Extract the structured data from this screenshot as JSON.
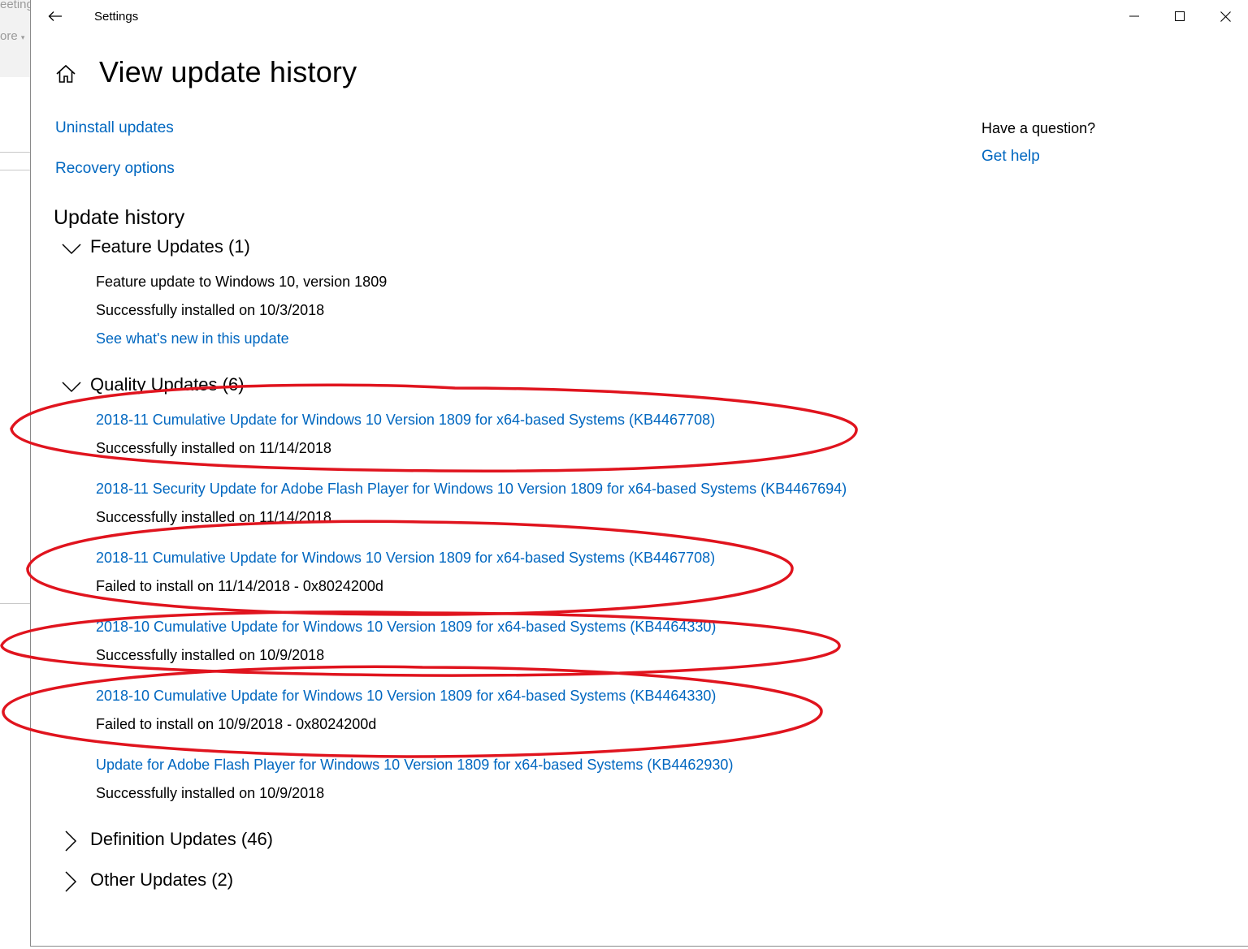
{
  "background_app": {
    "fragments": [
      "eeting",
      "ore"
    ]
  },
  "window": {
    "title": "Settings",
    "back_icon": "arrow-left-icon",
    "minimize_icon": "minimize-icon",
    "maximize_icon": "maximize-icon",
    "close_icon": "close-icon"
  },
  "page": {
    "home_icon": "home-icon",
    "title": "View update history"
  },
  "links": {
    "uninstall": "Uninstall updates",
    "recovery": "Recovery options"
  },
  "help": {
    "question": "Have a question?",
    "get_help": "Get help"
  },
  "history": {
    "heading": "Update history",
    "feature": {
      "header": "Feature Updates (1)",
      "expanded": true,
      "items": [
        {
          "title": "Feature update to Windows 10, version 1809",
          "status": "Successfully installed on 10/3/2018",
          "link": "See what's new in this update"
        }
      ]
    },
    "quality": {
      "header": "Quality Updates (6)",
      "expanded": true,
      "items": [
        {
          "title": "2018-11 Cumulative Update for Windows 10 Version 1809 for x64-based Systems (KB4467708)",
          "status": "Successfully installed on 11/14/2018"
        },
        {
          "title": "2018-11 Security Update for Adobe Flash Player for Windows 10 Version 1809 for x64-based Systems (KB4467694)",
          "status": "Successfully installed on 11/14/2018"
        },
        {
          "title": "2018-11 Cumulative Update for Windows 10 Version 1809 for x64-based Systems (KB4467708)",
          "status": "Failed to install on 11/14/2018 - 0x8024200d"
        },
        {
          "title": "2018-10 Cumulative Update for Windows 10 Version 1809 for x64-based Systems (KB4464330)",
          "status": "Successfully installed on 10/9/2018"
        },
        {
          "title": "2018-10 Cumulative Update for Windows 10 Version 1809 for x64-based Systems (KB4464330)",
          "status": "Failed to install on 10/9/2018 - 0x8024200d"
        },
        {
          "title": "Update for Adobe Flash Player for Windows 10 Version 1809 for x64-based Systems (KB4462930)",
          "status": "Successfully installed on 10/9/2018"
        }
      ]
    },
    "definition": {
      "header": "Definition Updates (46)",
      "expanded": false
    },
    "other": {
      "header": "Other Updates (2)",
      "expanded": false
    }
  },
  "colors": {
    "link": "#0067c0",
    "annotation": "#e0141e"
  }
}
